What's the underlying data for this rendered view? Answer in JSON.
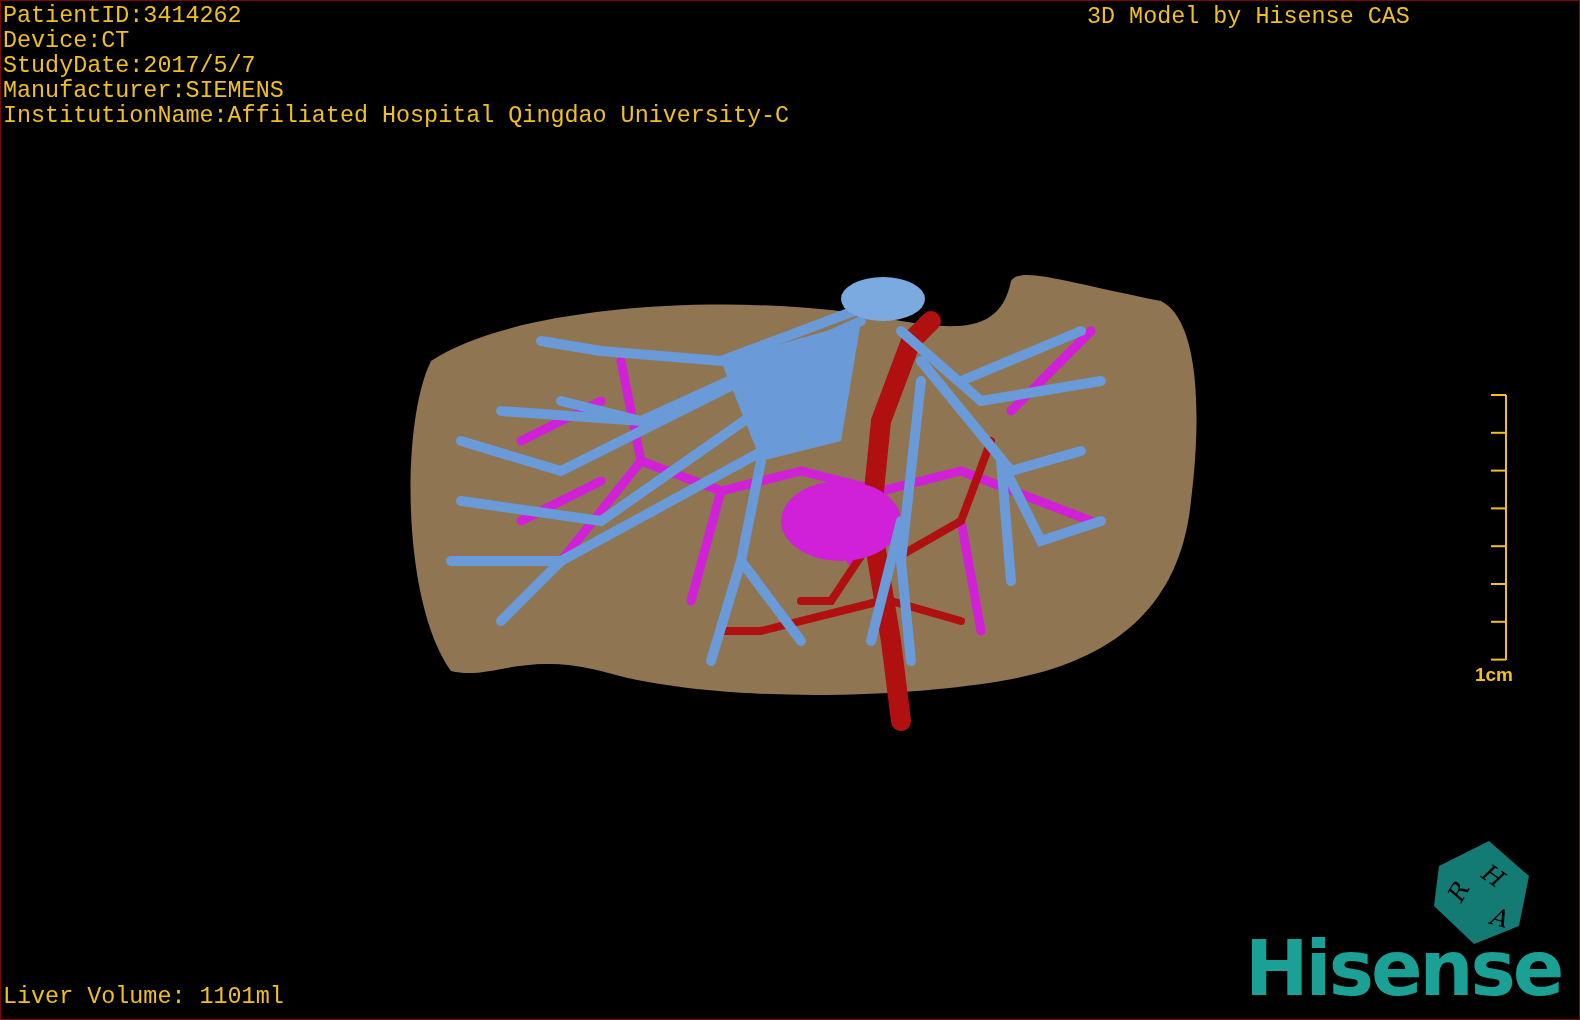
{
  "info_lines": [
    "PatientID:3414262",
    "Device:CT",
    "StudyDate:2017/5/7",
    "Manufacturer:SIEMENS",
    "InstitutionName:Affiliated Hospital Qingdao University-C"
  ],
  "credit": "3D Model by Hisense CAS",
  "scale_bar": {
    "label": "1cm"
  },
  "orientation_cube": {
    "faces": [
      "H",
      "R",
      "A"
    ]
  },
  "logo": "Hisense",
  "volume": "Liver Volume: 1101ml"
}
